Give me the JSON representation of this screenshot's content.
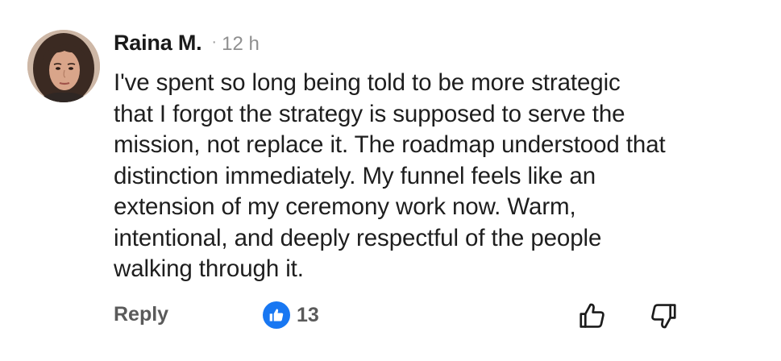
{
  "comment": {
    "author": "Raina M.",
    "separator": "·",
    "time": "12 h",
    "avatar_icon": "profile-photo",
    "body_lines": [
      "I've spent so long being told to be more strategic",
      "that I forgot the strategy is supposed to serve the",
      "mission, not replace it. The roadmap understood that",
      "distinction immediately. My funnel feels like an",
      "extension of my ceremony work now. Warm,",
      "intentional, and deeply respectful of the people",
      "walking through it."
    ]
  },
  "actions": {
    "reply_label": "Reply",
    "reaction_icon": "like-badge-icon",
    "reaction_count": "13",
    "like_icon": "thumbs-up-icon",
    "dislike_icon": "thumbs-down-icon"
  },
  "colors": {
    "like_blue": "#1877f2",
    "text": "#1e1e1e",
    "muted": "#8f8f8f",
    "action_gray": "#5a5a5a"
  }
}
